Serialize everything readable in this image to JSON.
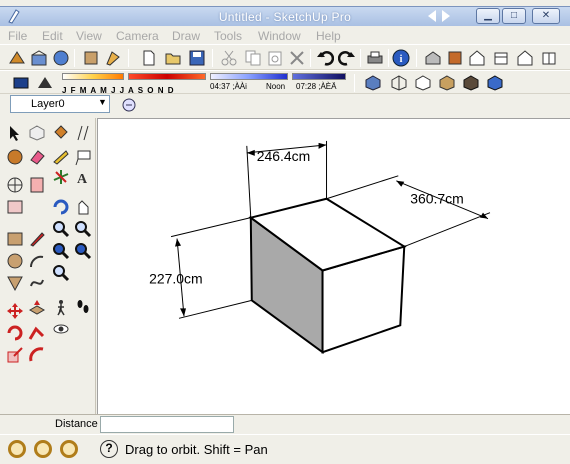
{
  "window": {
    "title": "Untitled - SketchUp Pro"
  },
  "menu": [
    "File",
    "Edit",
    "View",
    "Camera",
    "Draw",
    "Tools",
    "Window",
    "Help"
  ],
  "toolbar_main": {
    "icons": [
      "new-icon",
      "open-icon",
      "save-icon",
      "cut-icon",
      "copy-icon",
      "paste-icon",
      "erase-icon",
      "undo-icon",
      "redo-icon",
      "print-icon",
      "model-info-icon",
      "warehouse-icon",
      "components-icon",
      "home-icon",
      "share-icon",
      "extension-icon"
    ]
  },
  "shadow_bar": {
    "months": "J F M A M J J A S O N D",
    "time_start": "04:37 ;ÀÀi",
    "time_noon": "Noon",
    "time_end": "07:28 ;ÀÈÄ"
  },
  "layer_bar": {
    "layer_name": "Layer0"
  },
  "model": {
    "dimensions": {
      "depth": "246.4cm",
      "width": "360.7cm",
      "height": "227.0cm"
    }
  },
  "measurements": {
    "label": "Distance",
    "value": ""
  },
  "status": {
    "hint": "Drag to orbit.  Shift = Pan"
  },
  "colors": {
    "box_side_shade": "#a9a9a9",
    "box_front": "#ffffff",
    "title_bar": "#b5c9ea"
  }
}
